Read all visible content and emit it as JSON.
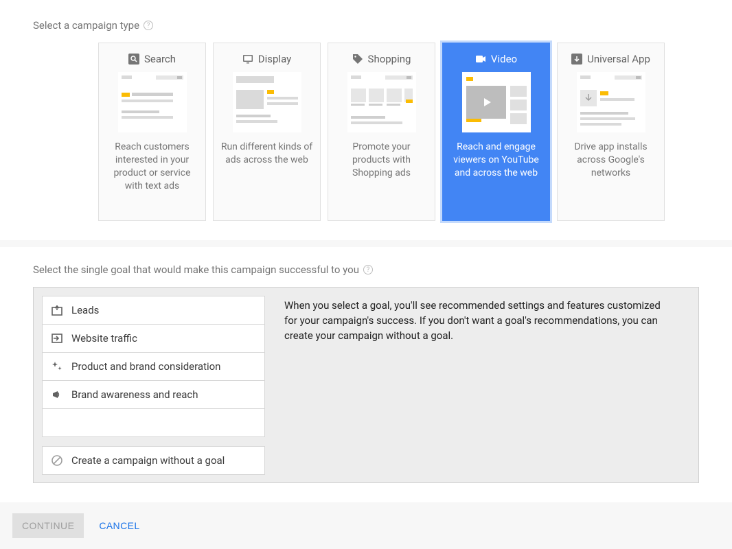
{
  "campaign_type": {
    "label": "Select a campaign type",
    "cards": [
      {
        "title": "Search",
        "desc": "Reach customers interested in your product or service with text ads",
        "selected": false
      },
      {
        "title": "Display",
        "desc": "Run different kinds of ads across the web",
        "selected": false
      },
      {
        "title": "Shopping",
        "desc": "Promote your products with Shopping ads",
        "selected": false
      },
      {
        "title": "Video",
        "desc": "Reach and engage viewers on YouTube and across the web",
        "selected": true
      },
      {
        "title": "Universal App",
        "desc": "Drive app installs across Google's networks",
        "selected": false
      }
    ]
  },
  "goal_section": {
    "label": "Select the single goal that would make this campaign successful to you",
    "items": [
      {
        "label": "Leads"
      },
      {
        "label": "Website traffic"
      },
      {
        "label": "Product and brand consideration"
      },
      {
        "label": "Brand awareness and reach"
      }
    ],
    "no_goal": {
      "label": "Create a campaign without a goal"
    },
    "description": "When you select a goal, you'll see recommended settings and features customized for your campaign's success. If you don't want a goal's recommendations, you can create your campaign without a goal."
  },
  "actions": {
    "continue": "CONTINUE",
    "cancel": "CANCEL"
  }
}
